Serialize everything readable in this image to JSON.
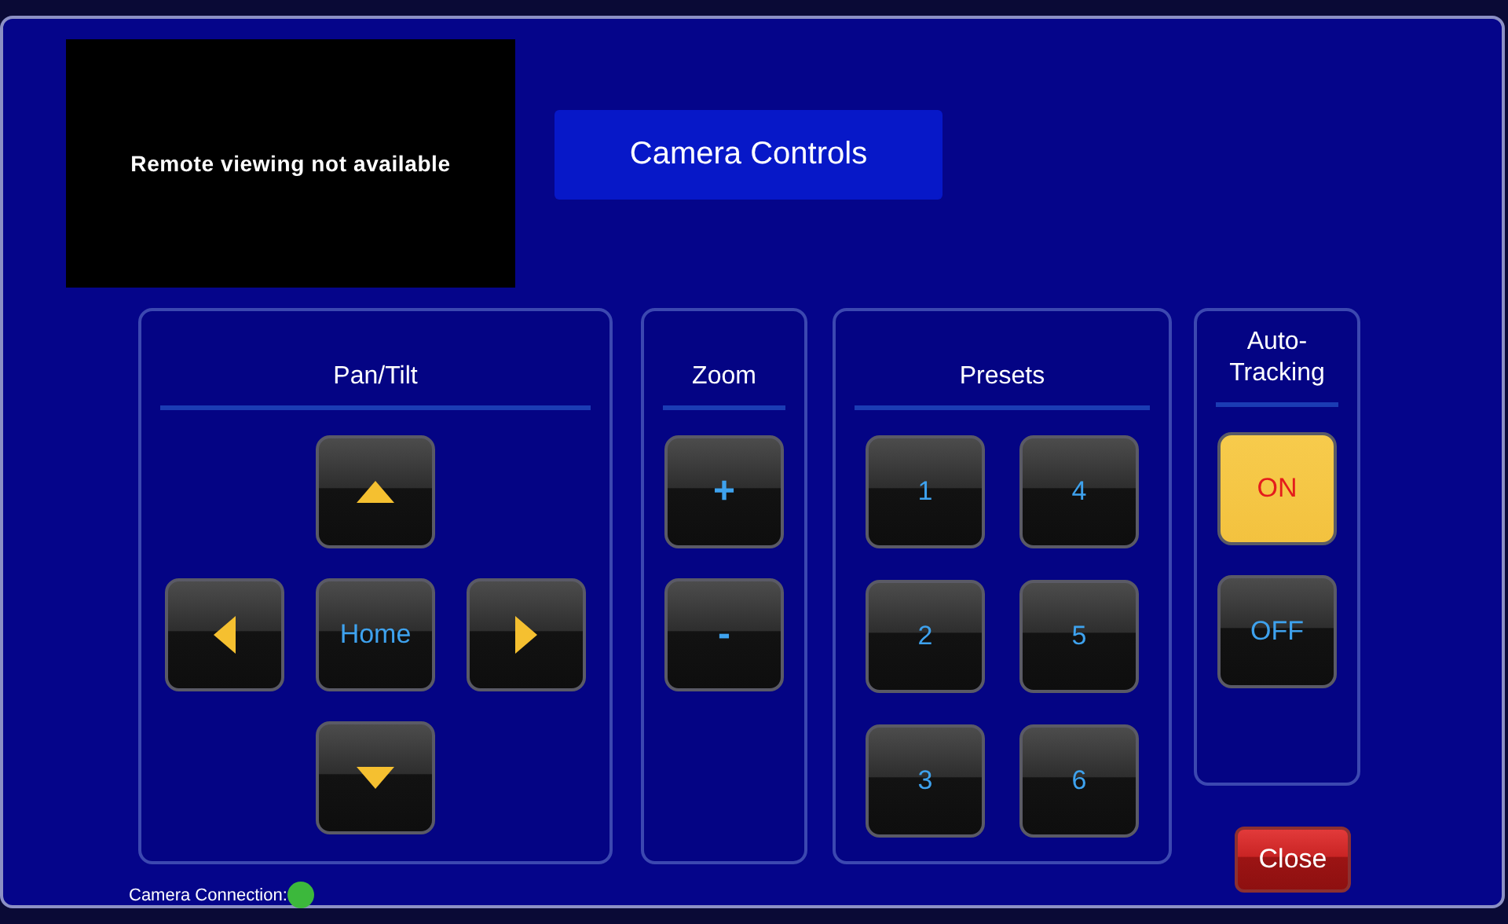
{
  "video": {
    "message": "Remote viewing not available"
  },
  "title": "Camera Controls",
  "pan_tilt": {
    "title": "Pan/Tilt",
    "buttons": [
      {
        "kind": "up"
      },
      {
        "kind": "left"
      },
      {
        "kind": "home",
        "label": "Home"
      },
      {
        "kind": "right"
      },
      {
        "kind": "down"
      }
    ]
  },
  "zoom": {
    "title": "Zoom",
    "buttons": [
      "+",
      "-"
    ]
  },
  "presets": {
    "title": "Presets",
    "buttons": [
      "1",
      "2",
      "3",
      "4",
      "5",
      "6"
    ]
  },
  "auto_tracking": {
    "title": "Auto-Tracking",
    "options": [
      {
        "label": "ON",
        "selected": true
      },
      {
        "label": "OFF",
        "selected": false
      }
    ]
  },
  "close": "Close",
  "status": {
    "label": "Camera Connection:",
    "connected": true
  }
}
